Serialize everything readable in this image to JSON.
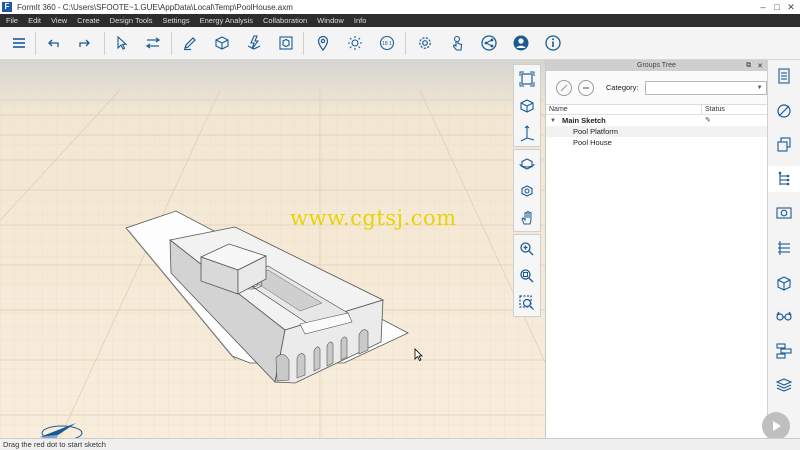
{
  "window": {
    "app_logo": "F",
    "title": "FormIt 360 - C:\\Users\\SFOOTE~1.GUE\\AppData\\Local\\Temp\\PoolHouse.axm",
    "controls": [
      "minimize-icon",
      "maximize-icon",
      "close-icon"
    ]
  },
  "menu": {
    "items": [
      "File",
      "Edit",
      "View",
      "Create",
      "Design Tools",
      "Settings",
      "Energy Analysis",
      "Collaboration",
      "Window",
      "Info"
    ]
  },
  "toolbar": {
    "icons": [
      "menu-list-icon",
      "undo-icon",
      "redo-icon",
      "select-arrow-icon",
      "move-icon",
      "sketch-pencil-icon",
      "cube-icon",
      "lightning-cube-icon",
      "frame-cube-icon",
      "location-pin-icon",
      "sun-icon",
      "date-icon",
      "settings-gear-icon",
      "touch-icon",
      "share-icon",
      "user-account-icon",
      "info-icon"
    ]
  },
  "viewport": {
    "watermark": "www.cgtsj.com",
    "view_tools": [
      "view-frame-icon",
      "view-cube-icon",
      "view-axis-icon",
      "orbit-icon",
      "walk-icon",
      "pan-hand-icon",
      "zoom-in-icon",
      "zoom-extents-icon",
      "zoom-selection-icon"
    ],
    "compass_icon": "north-arrow-icon",
    "colors": {
      "sky": "#d6d5d1",
      "ground": "#f8eddb",
      "grid": "#e3d7c2"
    }
  },
  "groups_panel": {
    "title": "Groups Tree",
    "category_label": "Category:",
    "category_value": "",
    "columns": {
      "name": "Name",
      "status": "Status"
    },
    "root": "Main Sketch",
    "children": [
      "Pool Platform",
      "Pool House"
    ]
  },
  "sidebar": {
    "icons": [
      "properties-list-icon",
      "materials-icon",
      "layers-icon",
      "groups-tree-icon",
      "scenes-camera-icon",
      "levels-icon",
      "components-icon",
      "visual-styles-icon",
      "hierarchy-icon",
      "stack-layers-icon"
    ],
    "active_index": 3
  },
  "statusbar": {
    "text": "Drag the red dot to start sketch"
  }
}
